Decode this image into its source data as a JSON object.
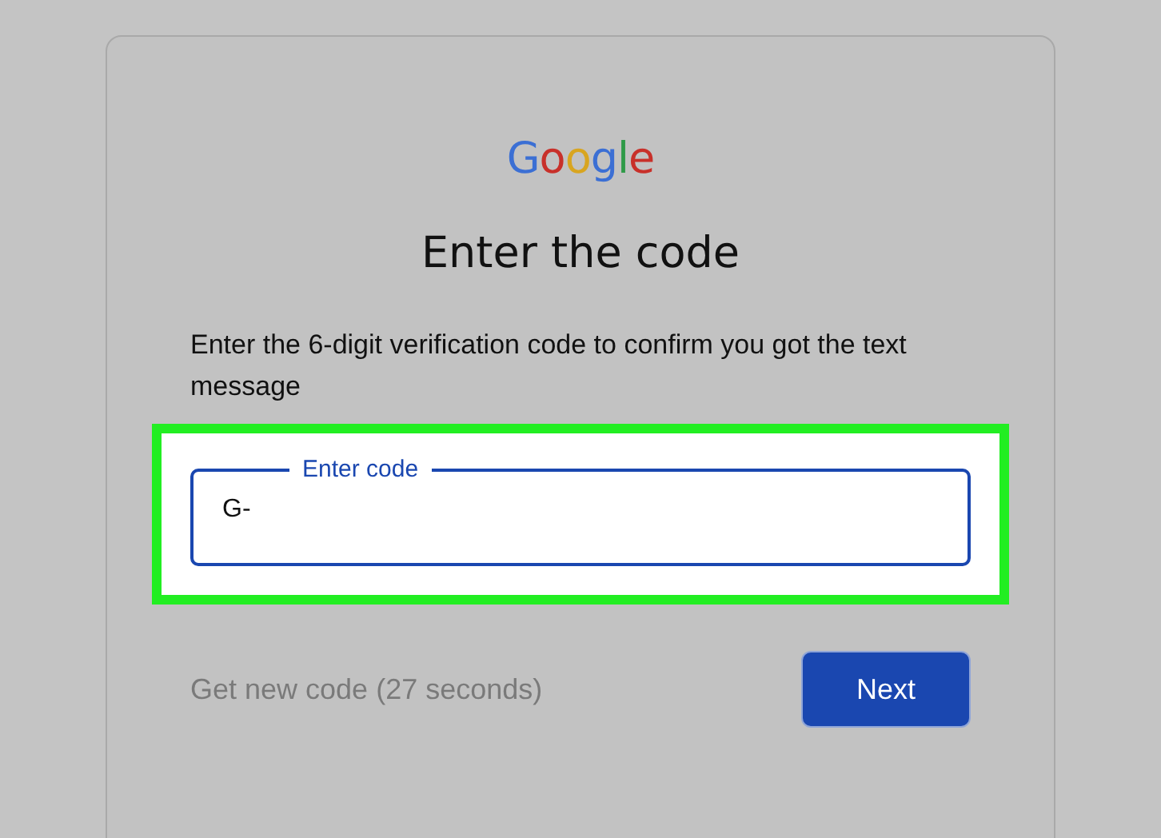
{
  "logo": "Google",
  "title": "Enter the code",
  "description": "Enter the 6-digit verification code to confirm you got the text message",
  "code_field": {
    "label": "Enter code",
    "value": "G-",
    "focused": true,
    "highlighted": true
  },
  "resend_link": {
    "label": "Get new code (27 seconds)",
    "disabled": true
  },
  "next_button": {
    "label": "Next"
  }
}
